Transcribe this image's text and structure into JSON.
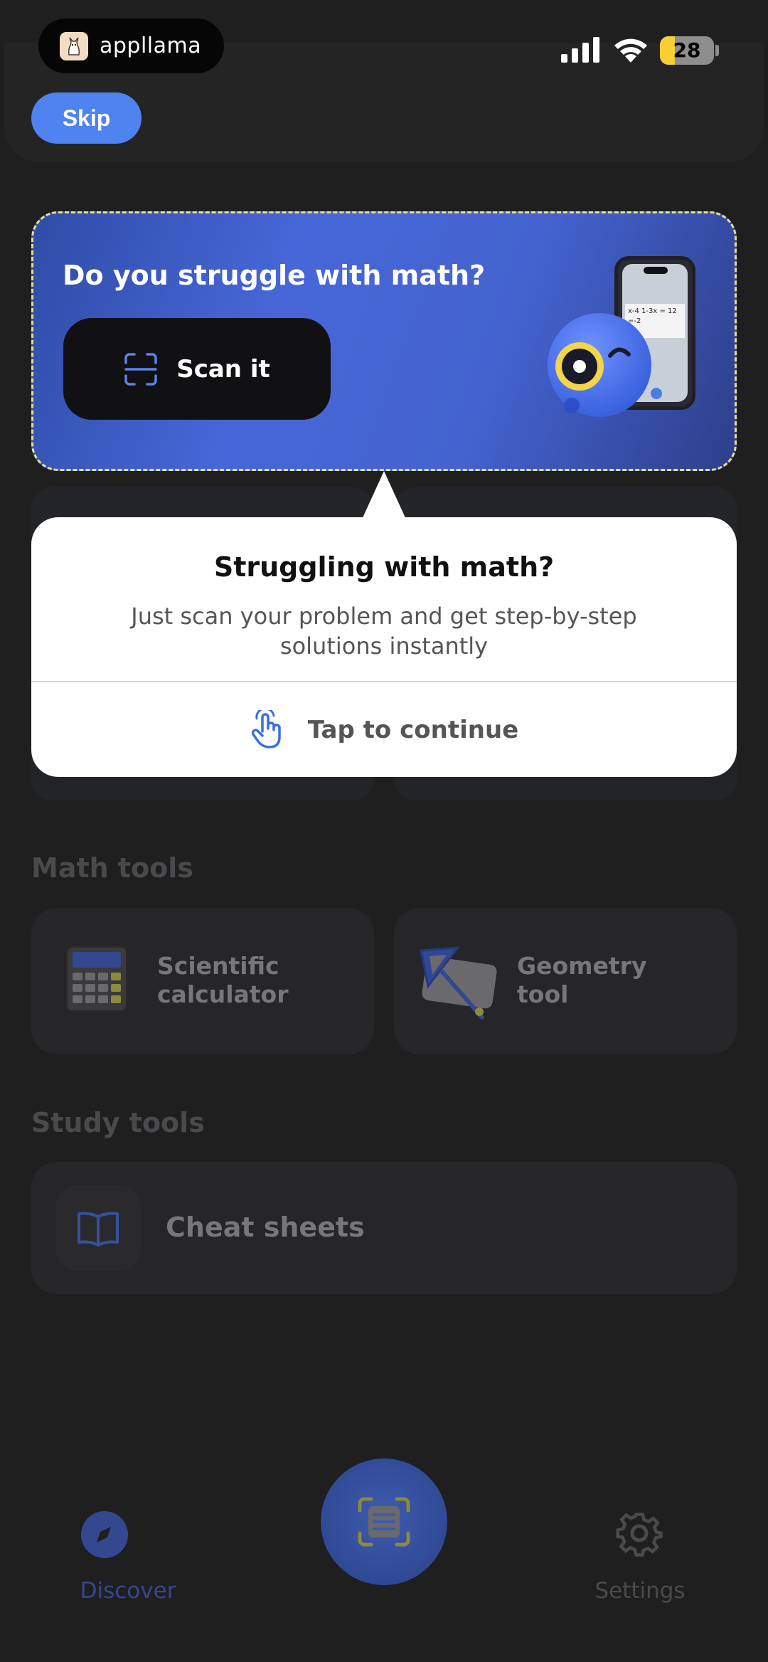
{
  "status_bar": {
    "brand": "appllama",
    "battery": "28",
    "battery_level": 0.28
  },
  "header": {
    "skip_label": "Skip"
  },
  "banner": {
    "title": "Do you struggle with math?",
    "scan_label": "Scan it",
    "paper_text": "x-4 1-3x = 12 =-2"
  },
  "popup": {
    "title": "Struggling with math?",
    "body": "Just scan your problem and get step-by-step solutions instantly",
    "cta": "Tap to continue"
  },
  "math_tools": {
    "title": "Math tools",
    "items": [
      {
        "label_line1": "Scientific",
        "label_line2": "calculator"
      },
      {
        "label_line1": "Geometry",
        "label_line2": "tool"
      }
    ]
  },
  "study_tools": {
    "title": "Study tools",
    "items": [
      {
        "label": "Cheat sheets"
      }
    ]
  },
  "bottom_nav": {
    "discover": "Discover",
    "settings": "Settings"
  },
  "colors": {
    "accent": "#4f83f0",
    "background": "#1f1f20",
    "popup": "#ffffff",
    "banner_dash": "#e8e08a"
  }
}
